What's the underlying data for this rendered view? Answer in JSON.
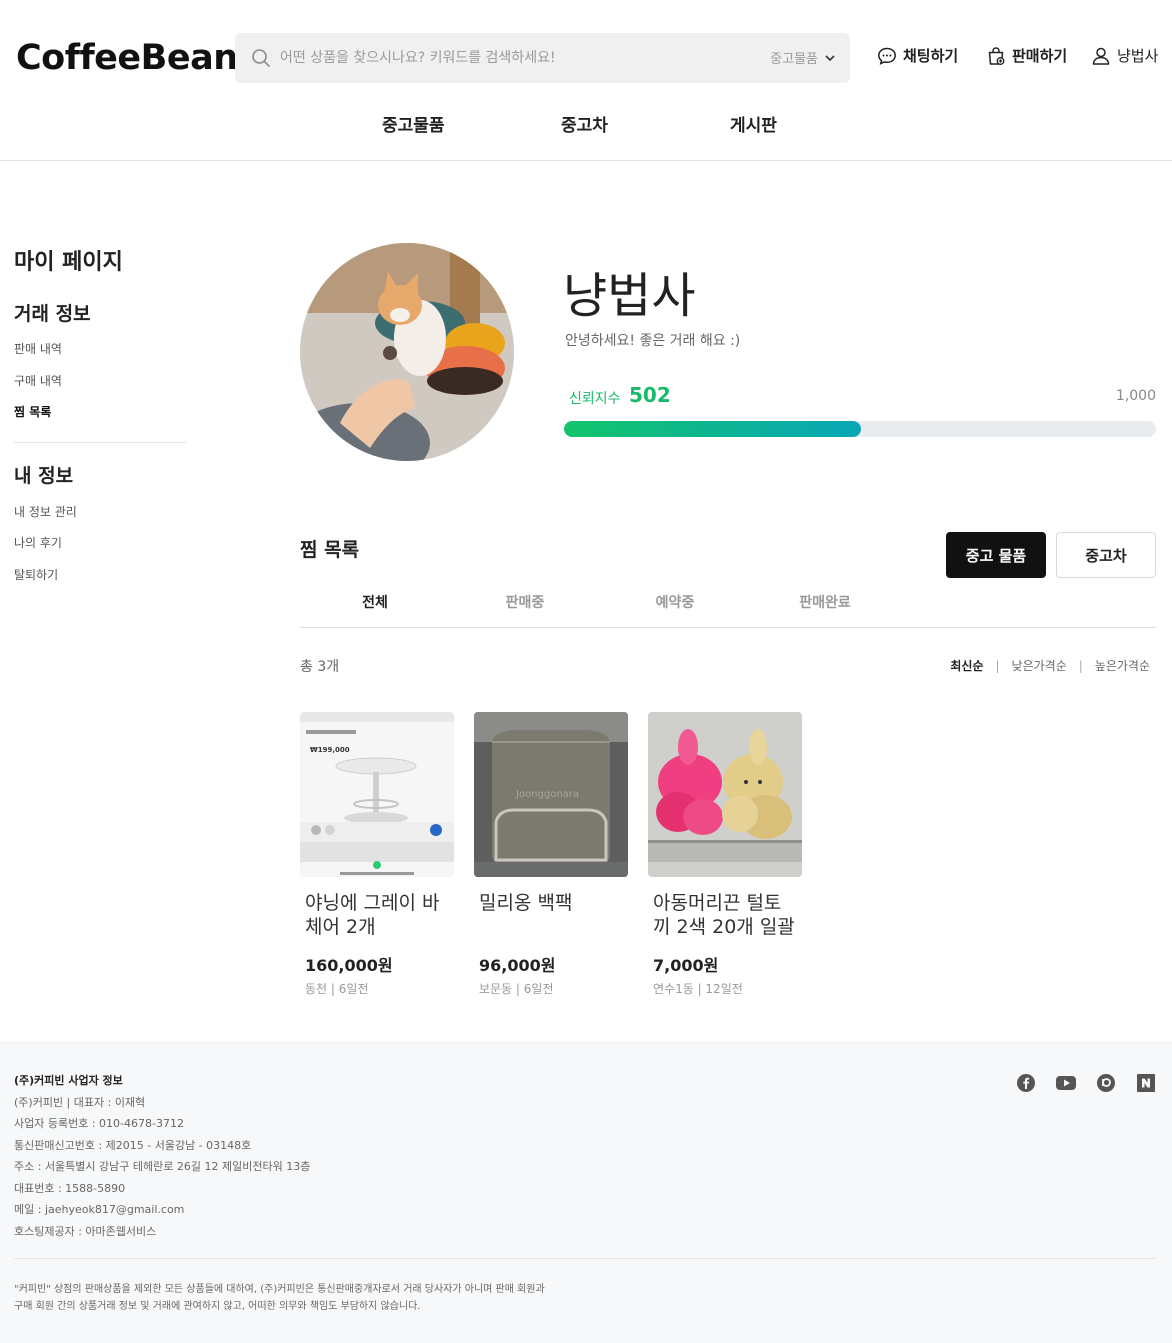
{
  "header": {
    "logo": "CoffeeBean",
    "search_placeholder": "어떤 상품을 찾으시나요? 키워드를 검색하세요!",
    "search_category": "중고물품",
    "chat": "채팅하기",
    "sell": "판매하기",
    "user": "냥법사",
    "nav": [
      "중고물품",
      "중고차",
      "게시판"
    ]
  },
  "sidebar": {
    "title": "마이 페이지",
    "trade_heading": "거래 정보",
    "trade_items": [
      "판매 내역",
      "구매 내역",
      "찜 목록"
    ],
    "info_heading": "내 정보",
    "info_items": [
      "내 정보 관리",
      "나의 후기",
      "탈퇴하기"
    ]
  },
  "profile": {
    "name": "냥법사",
    "intro": "안녕하세요! 좋은 거래 해요 :)",
    "trust_label": "신뢰지수",
    "trust_value": "502",
    "trust_max": "1,000",
    "trust_fraction": 0.502
  },
  "wishlist": {
    "title": "찜 목록",
    "btn_used": "중고 물품",
    "btn_car": "중고차",
    "tabs": [
      "전체",
      "판매중",
      "예약중",
      "판매완료"
    ],
    "total": "총 3개",
    "sort": [
      "최신순",
      "낮은가격순",
      "높은가격순"
    ],
    "items": [
      {
        "title": "야닝에 그레이 바 체어 2개",
        "price": "160,000원",
        "meta": "동천 | 6일전"
      },
      {
        "title": "밀리옹 백팩",
        "price": "96,000원",
        "meta": "보문동 | 6일전"
      },
      {
        "title": "아동머리끈 털토끼 2색 20개 일괄",
        "price": "7,000원",
        "meta": "연수1동 | 12일전"
      }
    ],
    "thumb1_text": "₩199,000",
    "thumb2_text": "Joonggonara"
  },
  "footer": {
    "title": "(주)커피빈 사업자 정보",
    "lines": [
      "(주)커피빈 | 대표자 : 이재혁",
      "사업자 등록번호 : 010-4678-3712",
      "통신판매신고번호 : 제2015 - 서울강남 - 03148호",
      "주소 : 서울특별시 강남구 테헤란로 26길 12 제일비전타워 13층",
      "대표번호 : 1588-5890",
      "메일 : jaehyeok817@gmail.com",
      "호스팅제공자 : 아마존웹서비스"
    ],
    "disclaimer1": "\"커피빈\" 상점의 판매상품을 제외한 모든 상품들에 대하여, (주)커피빈은 통신판매중개자로서 거래 당사자가 아니며 판매 회원과",
    "disclaimer2": "구매 회원 간의 상품거래 정보 및 거래에 관여하지 않고, 어떠한 의무와 책임도 부담하지 않습니다."
  }
}
